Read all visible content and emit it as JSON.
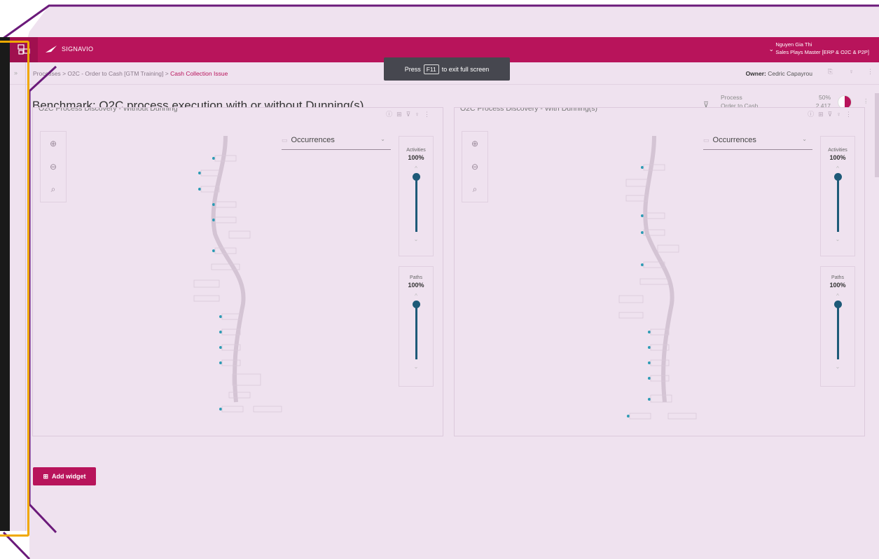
{
  "app": {
    "brand": "SIGNAVIO",
    "user_name": "Nguyen Gia Thi",
    "user_role": "Sales Plays Master [ERP & O2C & P2P]"
  },
  "breadcrumb": {
    "items": [
      "Processes",
      "O2C - Order to Cash [GTM Training]"
    ],
    "current": "Cash Collection Issue",
    "separator": ">"
  },
  "toast": {
    "prefix": "Press",
    "key": "F11",
    "suffix": "to exit full screen"
  },
  "owner": {
    "label": "Owner:",
    "name": "Cedric Capayrou"
  },
  "page": {
    "title": "Benchmark: O2C process execution with or without Dunning(s)"
  },
  "summary": {
    "process_label": "Process",
    "process_name": "Order to Cash",
    "percent": "50%",
    "count": "2,417"
  },
  "widgets": [
    {
      "title": "O2C Process Discovery - Without Dunning",
      "metric": "Occurrences",
      "activities_label": "Activities",
      "activities_value": "100%",
      "paths_label": "Paths",
      "paths_value": "100%"
    },
    {
      "title": "O2C Process Discovery - With Dunning(s)",
      "metric": "Occurrences",
      "activities_label": "Activities",
      "activities_value": "100%",
      "paths_label": "Paths",
      "paths_value": "100%"
    }
  ],
  "add_widget": {
    "label": "Add widget"
  },
  "colors": {
    "brand": "#b8145b",
    "frame": "#6b1a7a",
    "slider": "#1e5a78",
    "highlight": "#f0a800"
  },
  "icons": [
    "home-icon",
    "signavio-logo-icon",
    "zoom-in-icon",
    "zoom-out-icon",
    "fit-icon",
    "filter-icon",
    "info-icon",
    "more-icon",
    "plus-icon"
  ]
}
